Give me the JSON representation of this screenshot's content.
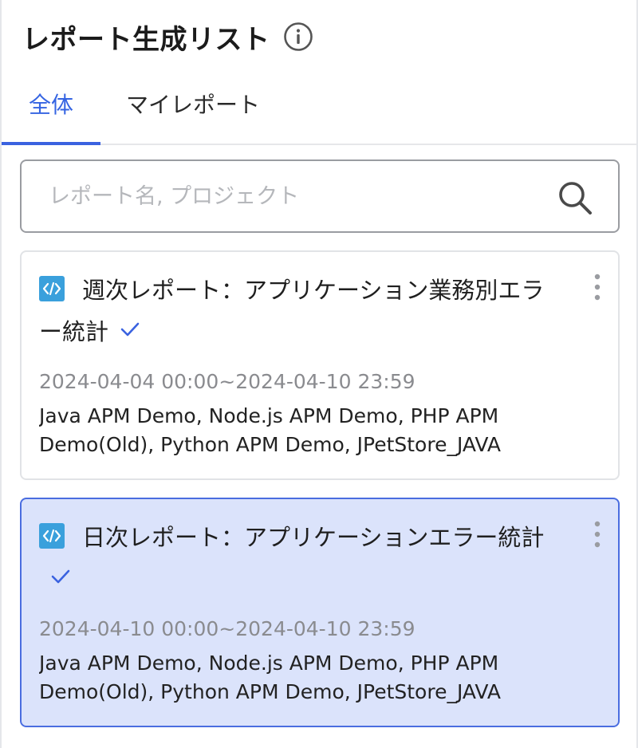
{
  "header": {
    "title": "レポート生成リスト"
  },
  "tabs": [
    {
      "label": "全体",
      "active": true
    },
    {
      "label": "マイレポート",
      "active": false
    }
  ],
  "search": {
    "placeholder": "レポート名, プロジェクト",
    "value": ""
  },
  "reports": [
    {
      "title": "週次レポート：アプリケーション業務別エラー統計",
      "period": "2024-04-04 00:00~2024-04-10 23:59",
      "projects": "Java APM Demo, Node.js APM Demo, PHP APM Demo(Old), Python APM Demo, JPetStore_JAVA",
      "selected": false
    },
    {
      "title": "日次レポート：アプリケーションエラー統計",
      "period": "2024-04-10 00:00~2024-04-10 23:59",
      "projects": "Java APM Demo, Node.js APM Demo, PHP APM Demo(Old), Python APM Demo, JPetStore_JAVA",
      "selected": true
    }
  ],
  "colors": {
    "accent": "#3a62e0",
    "selected_bg": "#dbe3fb",
    "code_icon": "#3aa0dc",
    "muted_text": "#8a8b8f"
  },
  "icons": {
    "info": "info-icon",
    "search": "search-icon",
    "report_type": "code-icon",
    "status": "check-icon",
    "menu": "kebab-menu-icon"
  }
}
